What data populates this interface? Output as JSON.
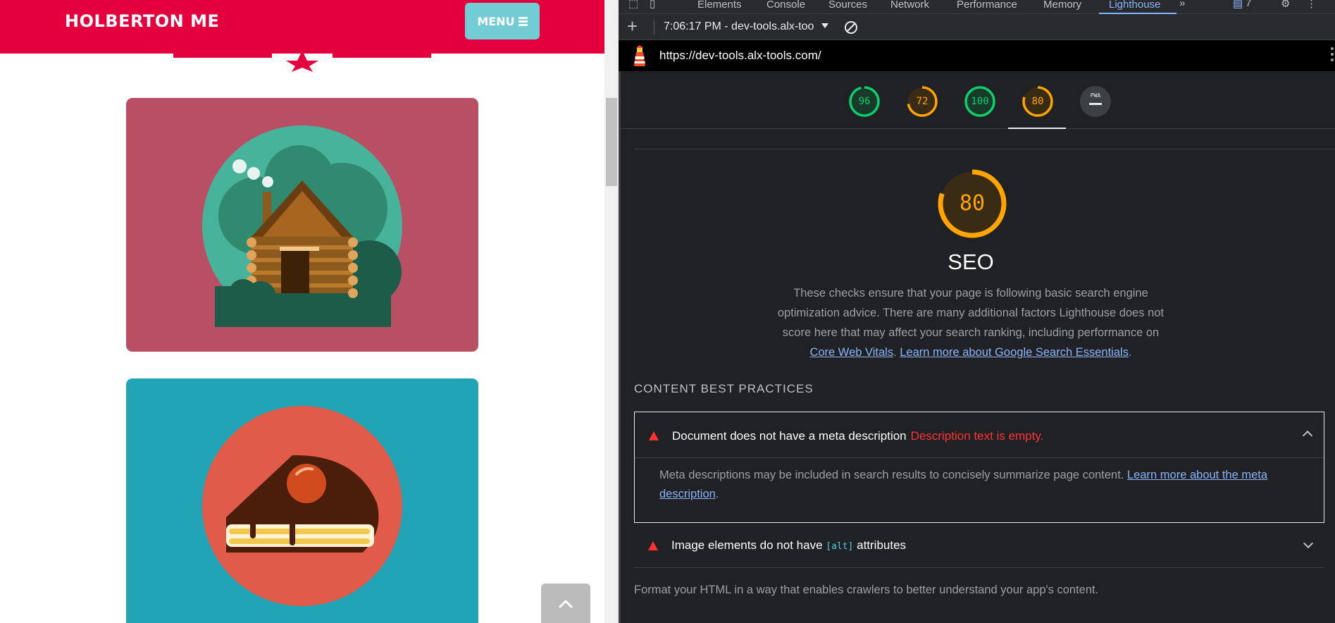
{
  "site": {
    "brand": "HOLBERTON ME",
    "menu_label": "MENU",
    "colors": {
      "header": "#e4003c",
      "menu_button": "#72ccd3",
      "card_cabin": "#b94f65",
      "card_cake": "#21a4b5"
    },
    "cards": [
      {
        "illustration": "log-cabin-illustration"
      },
      {
        "illustration": "cake-slice-illustration"
      }
    ],
    "scroll_top_icon": "chevron-up-icon"
  },
  "devtools": {
    "tabs": [
      "Elements",
      "Console",
      "Sources",
      "Network",
      "Performance",
      "Memory",
      "Lighthouse"
    ],
    "active_tab": "Lighthouse",
    "overflow_icon": "»",
    "issues_count": "7",
    "toolbar": {
      "report_label": "7:06:17 PM - dev-tools.alx-too",
      "add_icon": "plus-icon",
      "clear_icon": "clear-icon"
    },
    "url": "https://dev-tools.alx-tools.com/",
    "scores": [
      {
        "value": "96",
        "color": "#0cce6b"
      },
      {
        "value": "72",
        "color": "#ffa400"
      },
      {
        "value": "100",
        "color": "#0cce6b"
      },
      {
        "value": "80",
        "color": "#ffa400"
      },
      {
        "value": "PWA",
        "color": "#9aa0a6"
      }
    ],
    "category": {
      "score": "80",
      "title": "SEO",
      "description_pre": "These checks ensure that your page is following basic search engine optimization advice. There are many additional factors Lighthouse does not score here that may affect your search ranking, including performance on ",
      "link1": "Core Web Vitals",
      "separator": ". ",
      "link2": "Learn more about Google Search Essentials",
      "description_post": "."
    },
    "group": {
      "title": "CONTENT BEST PRACTICES",
      "description": "Format your HTML in a way that enables crawlers to better understand your app's content."
    },
    "audits": [
      {
        "title": "Document does not have a meta description",
        "error": "Description text is empty.",
        "description": "Meta descriptions may be included in search results to concisely summarize page content. ",
        "link": "Learn more about the meta description",
        "description_post": "."
      },
      {
        "title_pre": "Image elements do not have ",
        "code": "[alt]",
        "title_post": " attributes"
      }
    ]
  }
}
